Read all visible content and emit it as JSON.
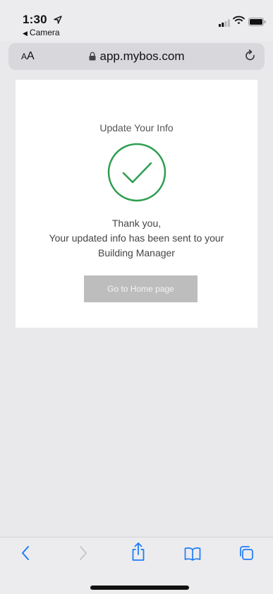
{
  "status_bar": {
    "time": "1:30",
    "back_app_label": "Camera"
  },
  "browser": {
    "text_size_label_small": "A",
    "text_size_label_large": "A",
    "url": "app.mybos.com"
  },
  "card": {
    "title": "Update Your Info",
    "message_line1": "Thank you,",
    "message_line2": "Your updated info has been sent to your",
    "message_line3": "Building Manager",
    "button_label": "Go to Home page"
  },
  "colors": {
    "check_green": "#2e9e50",
    "button_gray": "#bdbdbd",
    "ios_blue": "#1e7cf6"
  },
  "toolbar": {
    "icons": [
      "back-icon",
      "forward-icon",
      "share-icon",
      "bookmarks-icon",
      "tabs-icon"
    ]
  }
}
